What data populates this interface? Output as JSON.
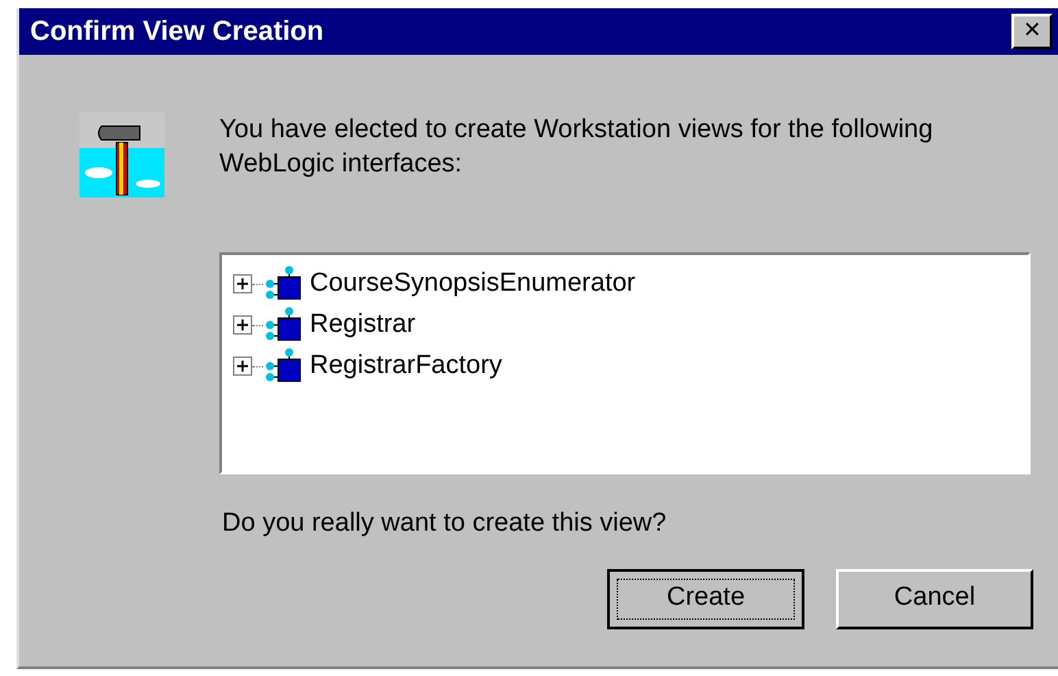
{
  "window": {
    "title": "Confirm View Creation",
    "close": "✕"
  },
  "message": "You have elected to create Workstation views for the following WebLogic interfaces:",
  "tree": {
    "items": [
      {
        "label": "CourseSynopsisEnumerator",
        "expanded": false
      },
      {
        "label": "Registrar",
        "expanded": false
      },
      {
        "label": "RegistrarFactory",
        "expanded": false
      }
    ]
  },
  "question": "Do you really want to create this view?",
  "buttons": [
    {
      "label": "Create",
      "default": true
    },
    {
      "label": "Cancel",
      "default": false
    }
  ]
}
